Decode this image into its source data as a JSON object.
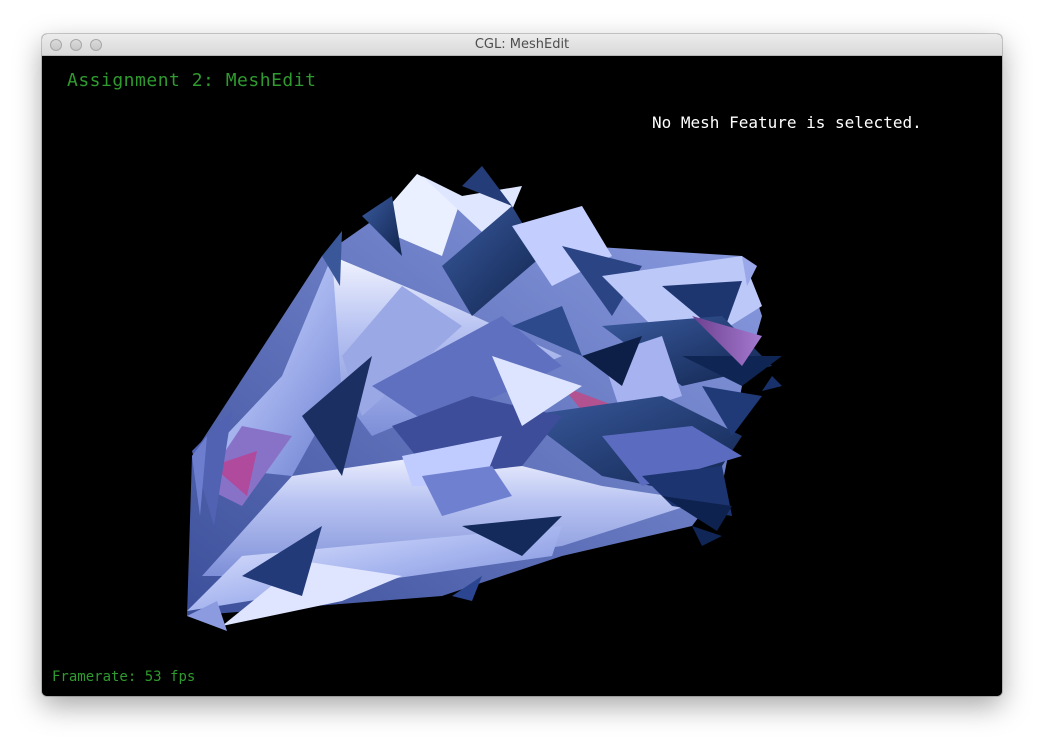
{
  "window": {
    "title": "CGL: MeshEdit"
  },
  "overlay": {
    "assignment_title": "Assignment 2: MeshEdit",
    "selection_status": "No Mesh Feature is selected.",
    "framerate_label": "Framerate:",
    "framerate_value": "53 fps"
  },
  "colors": {
    "background": "#000000",
    "title_green": "#2f9a2f",
    "status_white": "#ffffff",
    "mesh_light": "#c9d4ff",
    "mesh_mid": "#6f7fc8",
    "mesh_dark": "#1f3a72"
  },
  "icons": [
    "close-button",
    "minimize-button",
    "zoom-button"
  ]
}
